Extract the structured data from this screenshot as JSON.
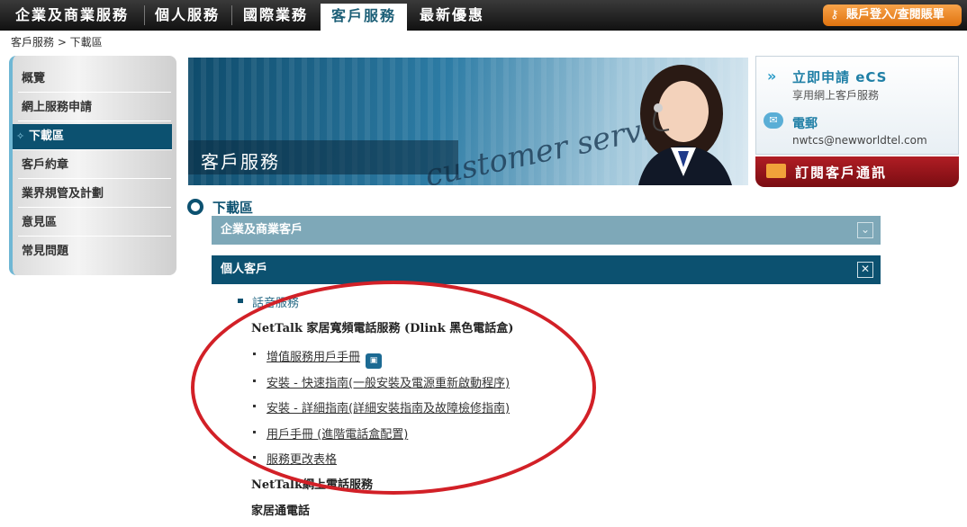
{
  "topnav": {
    "tabs": [
      {
        "label": "企業及商業服務"
      },
      {
        "label": "個人服務"
      },
      {
        "label": "國際業務"
      },
      {
        "label": "客戶服務"
      },
      {
        "label": "最新優惠"
      }
    ],
    "active_tab": "客戶服務",
    "login_label": "賬戶登入/查閱賬單"
  },
  "breadcrumb": "客戶服務 > 下載區",
  "sidebar": {
    "items": [
      {
        "label": "概覽"
      },
      {
        "label": "網上服務申請"
      },
      {
        "label": "下載區"
      },
      {
        "label": "客戶約章"
      },
      {
        "label": "業界規管及計劃"
      },
      {
        "label": "意見區"
      },
      {
        "label": "常見問題"
      }
    ],
    "active_item": "下載區"
  },
  "banner": {
    "title": "客戶服務",
    "script_text": "customer service"
  },
  "ecs": {
    "title": "立即申請 eCS",
    "subtitle": "享用網上客戶服務",
    "mail_title": "電郵",
    "mail_address": "nwtcs@newworldtel.com"
  },
  "subscribe_label": "訂閱客戶通訊",
  "section_title": "下載區",
  "accordion": {
    "business_label": "企業及商業客戶",
    "personal_label": "個人客戶"
  },
  "content": {
    "subheading": "話音服務",
    "product1": "NetTalk 家居寬頻電話服務 (Dlink 黑色電話盒)",
    "links": [
      "增值服務用戶手冊",
      "安裝 - 快速指南(一般安裝及電源重新啟動程序)",
      "安裝 - 詳細指南(詳細安裝指南及故障檢修指南)",
      "用戶手冊 (進階電話盒配置)",
      "服務更改表格"
    ],
    "product2": "NetTalk網上電話服務",
    "product3": "家居通電話"
  },
  "colors": {
    "brand": "#0c5170",
    "annotation_oval": "#d22027",
    "login_orange": "#f08a24"
  }
}
